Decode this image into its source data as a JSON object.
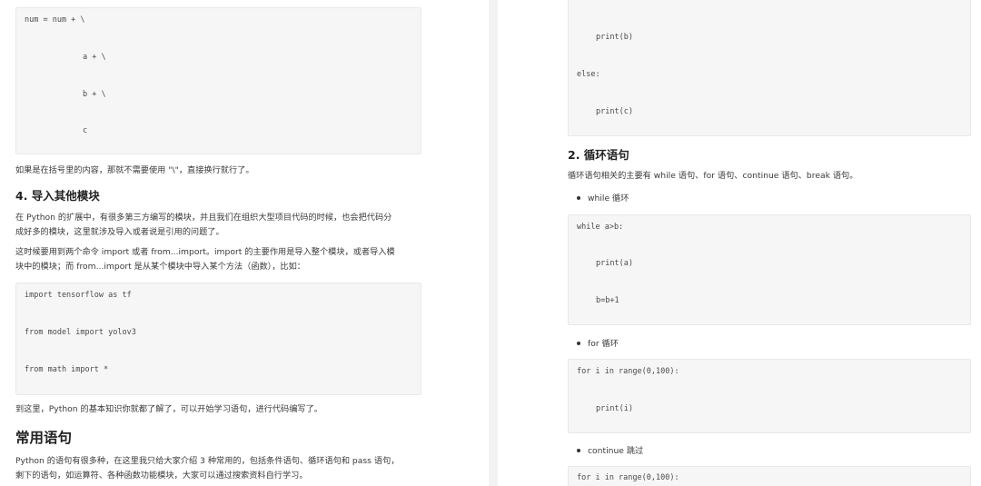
{
  "left": {
    "code_block_1": [
      "num = num + \\",
      "a + \\",
      "b + \\",
      "c"
    ],
    "paragraph_1": "如果是在括号里的内容，那就不需要使用 \"\\\"，直接换行就行了。",
    "heading_import": "4. 导入其他模块",
    "paragraph_2": [
      "在 Python 的扩展中，有很多第三方编写的模块，并且我们在组织大型项目代码的时候，也会把代码分",
      "成好多的模块，这里就涉及导入或者说是引用的问题了。"
    ],
    "paragraph_3": [
      "这时候要用到两个命令 import 或者 from...import。import 的主要作用是导入整个模块，或者导入模",
      "块中的模块；而 from...import 是从某个模块中导入某个方法（函数），比如："
    ],
    "code_block_2": [
      "import tensorflow as tf",
      "from model import yolov3",
      "from math import *"
    ],
    "paragraph_4": "到这里，Python 的基本知识你就都了解了，可以开始学习语句，进行代码编写了。",
    "heading_statements": "常用语句",
    "paragraph_5": [
      "Python 的语句有很多种，在这里我只给大家介绍 3 种常用的，包括条件语句、循环语句和 pass 语句，",
      "剩下的语句，如运算符、各种函数功能模块，大家可以通过搜索资料自行学习。"
    ]
  },
  "right": {
    "code_block_1": [
      "print(b)",
      "else:",
      "print(c)"
    ],
    "heading_loop": "2. 循环语句",
    "paragraph_1": "循环语句相关的主要有 while 语句、for 语句、continue 语句、break 语句。",
    "bullet_while": "while 循环",
    "code_block_while": [
      "while a>b:",
      "print(a)",
      "b=b+1"
    ],
    "bullet_for": "for 循环",
    "code_block_for": [
      "for i in range(0,100):",
      "print(i)"
    ],
    "bullet_continue": "continue 跳过",
    "code_block_continue": [
      "for i in range(0,100):"
    ]
  }
}
